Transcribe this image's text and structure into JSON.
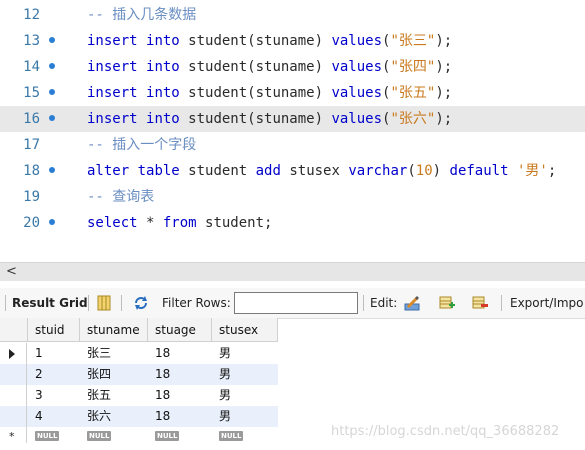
{
  "editor": {
    "lines": [
      {
        "num": "12",
        "breakpoint": false,
        "tokens": [
          {
            "t": "-- 插入几条数据",
            "c": "comment"
          }
        ]
      },
      {
        "num": "13",
        "breakpoint": true,
        "tokens": [
          {
            "t": "insert",
            "c": "keyword"
          },
          {
            "t": " ",
            "c": "plain"
          },
          {
            "t": "into",
            "c": "keyword"
          },
          {
            "t": " student(stuname) ",
            "c": "plain"
          },
          {
            "t": "values",
            "c": "keyword"
          },
          {
            "t": "(",
            "c": "plain"
          },
          {
            "t": "\"张三\"",
            "c": "str"
          },
          {
            "t": ");",
            "c": "plain"
          }
        ]
      },
      {
        "num": "14",
        "breakpoint": true,
        "tokens": [
          {
            "t": "insert",
            "c": "keyword"
          },
          {
            "t": " ",
            "c": "plain"
          },
          {
            "t": "into",
            "c": "keyword"
          },
          {
            "t": " student(stuname) ",
            "c": "plain"
          },
          {
            "t": "values",
            "c": "keyword"
          },
          {
            "t": "(",
            "c": "plain"
          },
          {
            "t": "\"张四\"",
            "c": "str"
          },
          {
            "t": ");",
            "c": "plain"
          }
        ]
      },
      {
        "num": "15",
        "breakpoint": true,
        "tokens": [
          {
            "t": "insert",
            "c": "keyword"
          },
          {
            "t": " ",
            "c": "plain"
          },
          {
            "t": "into",
            "c": "keyword"
          },
          {
            "t": " student(stuname) ",
            "c": "plain"
          },
          {
            "t": "values",
            "c": "keyword"
          },
          {
            "t": "(",
            "c": "plain"
          },
          {
            "t": "\"张五\"",
            "c": "str"
          },
          {
            "t": ");",
            "c": "plain"
          }
        ]
      },
      {
        "num": "16",
        "breakpoint": true,
        "current": true,
        "tokens": [
          {
            "t": "insert",
            "c": "keyword"
          },
          {
            "t": " ",
            "c": "plain"
          },
          {
            "t": "into",
            "c": "keyword"
          },
          {
            "t": " student(stuname) ",
            "c": "plain"
          },
          {
            "t": "values",
            "c": "keyword"
          },
          {
            "t": "(",
            "c": "plain"
          },
          {
            "t": "\"张六\"",
            "c": "str"
          },
          {
            "t": ");",
            "c": "plain"
          }
        ]
      },
      {
        "num": "17",
        "breakpoint": false,
        "tokens": [
          {
            "t": "-- 插入一个字段",
            "c": "comment"
          }
        ]
      },
      {
        "num": "18",
        "breakpoint": true,
        "tokens": [
          {
            "t": "alter",
            "c": "keyword"
          },
          {
            "t": " ",
            "c": "plain"
          },
          {
            "t": "table",
            "c": "keyword"
          },
          {
            "t": " student ",
            "c": "plain"
          },
          {
            "t": "add",
            "c": "keyword"
          },
          {
            "t": " stusex ",
            "c": "plain"
          },
          {
            "t": "varchar",
            "c": "keyword"
          },
          {
            "t": "(",
            "c": "plain"
          },
          {
            "t": "10",
            "c": "num"
          },
          {
            "t": ") ",
            "c": "plain"
          },
          {
            "t": "default",
            "c": "keyword"
          },
          {
            "t": " ",
            "c": "plain"
          },
          {
            "t": "'男'",
            "c": "str"
          },
          {
            "t": ";",
            "c": "plain"
          }
        ]
      },
      {
        "num": "19",
        "breakpoint": false,
        "tokens": [
          {
            "t": "-- 查询表",
            "c": "comment"
          }
        ]
      },
      {
        "num": "20",
        "breakpoint": true,
        "tokens": [
          {
            "t": "select",
            "c": "keyword"
          },
          {
            "t": " * ",
            "c": "plain"
          },
          {
            "t": "from",
            "c": "keyword"
          },
          {
            "t": " student;",
            "c": "plain"
          }
        ]
      }
    ]
  },
  "scrollbar": {
    "left_arrow": "<"
  },
  "toolbar": {
    "result_grid_label": "Result Grid",
    "filter_rows_label": "Filter Rows:",
    "filter_value": "",
    "edit_label": "Edit:",
    "export_label": "Export/Impo"
  },
  "grid": {
    "columns": [
      "stuid",
      "stuname",
      "stuage",
      "stusex"
    ],
    "rows": [
      [
        "1",
        "张三",
        "18",
        "男"
      ],
      [
        "2",
        "张四",
        "18",
        "男"
      ],
      [
        "3",
        "张五",
        "18",
        "男"
      ],
      [
        "4",
        "张六",
        "18",
        "男"
      ]
    ],
    "null_label": "NULL"
  },
  "watermark": "https://blog.csdn.net/qq_36688282",
  "colors": {
    "keyword": "#0000cc",
    "comment": "#6a8ec2",
    "string": "#c97a1e",
    "line_number": "#3a78a8",
    "breakpoint": "#2a7fd4",
    "row_alt": "#e9f0fb"
  }
}
